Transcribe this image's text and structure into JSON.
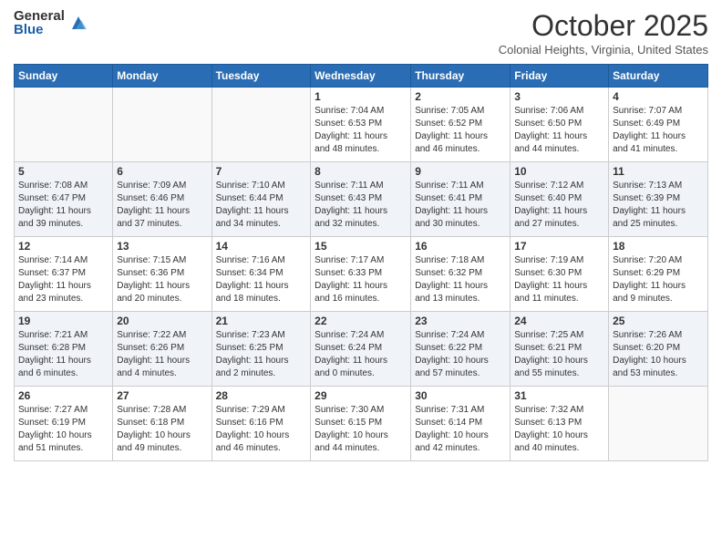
{
  "logo": {
    "general": "General",
    "blue": "Blue"
  },
  "title": "October 2025",
  "location": "Colonial Heights, Virginia, United States",
  "headers": [
    "Sunday",
    "Monday",
    "Tuesday",
    "Wednesday",
    "Thursday",
    "Friday",
    "Saturday"
  ],
  "weeks": [
    [
      {
        "day": "",
        "info": ""
      },
      {
        "day": "",
        "info": ""
      },
      {
        "day": "",
        "info": ""
      },
      {
        "day": "1",
        "info": "Sunrise: 7:04 AM\nSunset: 6:53 PM\nDaylight: 11 hours\nand 48 minutes."
      },
      {
        "day": "2",
        "info": "Sunrise: 7:05 AM\nSunset: 6:52 PM\nDaylight: 11 hours\nand 46 minutes."
      },
      {
        "day": "3",
        "info": "Sunrise: 7:06 AM\nSunset: 6:50 PM\nDaylight: 11 hours\nand 44 minutes."
      },
      {
        "day": "4",
        "info": "Sunrise: 7:07 AM\nSunset: 6:49 PM\nDaylight: 11 hours\nand 41 minutes."
      }
    ],
    [
      {
        "day": "5",
        "info": "Sunrise: 7:08 AM\nSunset: 6:47 PM\nDaylight: 11 hours\nand 39 minutes."
      },
      {
        "day": "6",
        "info": "Sunrise: 7:09 AM\nSunset: 6:46 PM\nDaylight: 11 hours\nand 37 minutes."
      },
      {
        "day": "7",
        "info": "Sunrise: 7:10 AM\nSunset: 6:44 PM\nDaylight: 11 hours\nand 34 minutes."
      },
      {
        "day": "8",
        "info": "Sunrise: 7:11 AM\nSunset: 6:43 PM\nDaylight: 11 hours\nand 32 minutes."
      },
      {
        "day": "9",
        "info": "Sunrise: 7:11 AM\nSunset: 6:41 PM\nDaylight: 11 hours\nand 30 minutes."
      },
      {
        "day": "10",
        "info": "Sunrise: 7:12 AM\nSunset: 6:40 PM\nDaylight: 11 hours\nand 27 minutes."
      },
      {
        "day": "11",
        "info": "Sunrise: 7:13 AM\nSunset: 6:39 PM\nDaylight: 11 hours\nand 25 minutes."
      }
    ],
    [
      {
        "day": "12",
        "info": "Sunrise: 7:14 AM\nSunset: 6:37 PM\nDaylight: 11 hours\nand 23 minutes."
      },
      {
        "day": "13",
        "info": "Sunrise: 7:15 AM\nSunset: 6:36 PM\nDaylight: 11 hours\nand 20 minutes."
      },
      {
        "day": "14",
        "info": "Sunrise: 7:16 AM\nSunset: 6:34 PM\nDaylight: 11 hours\nand 18 minutes."
      },
      {
        "day": "15",
        "info": "Sunrise: 7:17 AM\nSunset: 6:33 PM\nDaylight: 11 hours\nand 16 minutes."
      },
      {
        "day": "16",
        "info": "Sunrise: 7:18 AM\nSunset: 6:32 PM\nDaylight: 11 hours\nand 13 minutes."
      },
      {
        "day": "17",
        "info": "Sunrise: 7:19 AM\nSunset: 6:30 PM\nDaylight: 11 hours\nand 11 minutes."
      },
      {
        "day": "18",
        "info": "Sunrise: 7:20 AM\nSunset: 6:29 PM\nDaylight: 11 hours\nand 9 minutes."
      }
    ],
    [
      {
        "day": "19",
        "info": "Sunrise: 7:21 AM\nSunset: 6:28 PM\nDaylight: 11 hours\nand 6 minutes."
      },
      {
        "day": "20",
        "info": "Sunrise: 7:22 AM\nSunset: 6:26 PM\nDaylight: 11 hours\nand 4 minutes."
      },
      {
        "day": "21",
        "info": "Sunrise: 7:23 AM\nSunset: 6:25 PM\nDaylight: 11 hours\nand 2 minutes."
      },
      {
        "day": "22",
        "info": "Sunrise: 7:24 AM\nSunset: 6:24 PM\nDaylight: 11 hours\nand 0 minutes."
      },
      {
        "day": "23",
        "info": "Sunrise: 7:24 AM\nSunset: 6:22 PM\nDaylight: 10 hours\nand 57 minutes."
      },
      {
        "day": "24",
        "info": "Sunrise: 7:25 AM\nSunset: 6:21 PM\nDaylight: 10 hours\nand 55 minutes."
      },
      {
        "day": "25",
        "info": "Sunrise: 7:26 AM\nSunset: 6:20 PM\nDaylight: 10 hours\nand 53 minutes."
      }
    ],
    [
      {
        "day": "26",
        "info": "Sunrise: 7:27 AM\nSunset: 6:19 PM\nDaylight: 10 hours\nand 51 minutes."
      },
      {
        "day": "27",
        "info": "Sunrise: 7:28 AM\nSunset: 6:18 PM\nDaylight: 10 hours\nand 49 minutes."
      },
      {
        "day": "28",
        "info": "Sunrise: 7:29 AM\nSunset: 6:16 PM\nDaylight: 10 hours\nand 46 minutes."
      },
      {
        "day": "29",
        "info": "Sunrise: 7:30 AM\nSunset: 6:15 PM\nDaylight: 10 hours\nand 44 minutes."
      },
      {
        "day": "30",
        "info": "Sunrise: 7:31 AM\nSunset: 6:14 PM\nDaylight: 10 hours\nand 42 minutes."
      },
      {
        "day": "31",
        "info": "Sunrise: 7:32 AM\nSunset: 6:13 PM\nDaylight: 10 hours\nand 40 minutes."
      },
      {
        "day": "",
        "info": ""
      }
    ]
  ]
}
